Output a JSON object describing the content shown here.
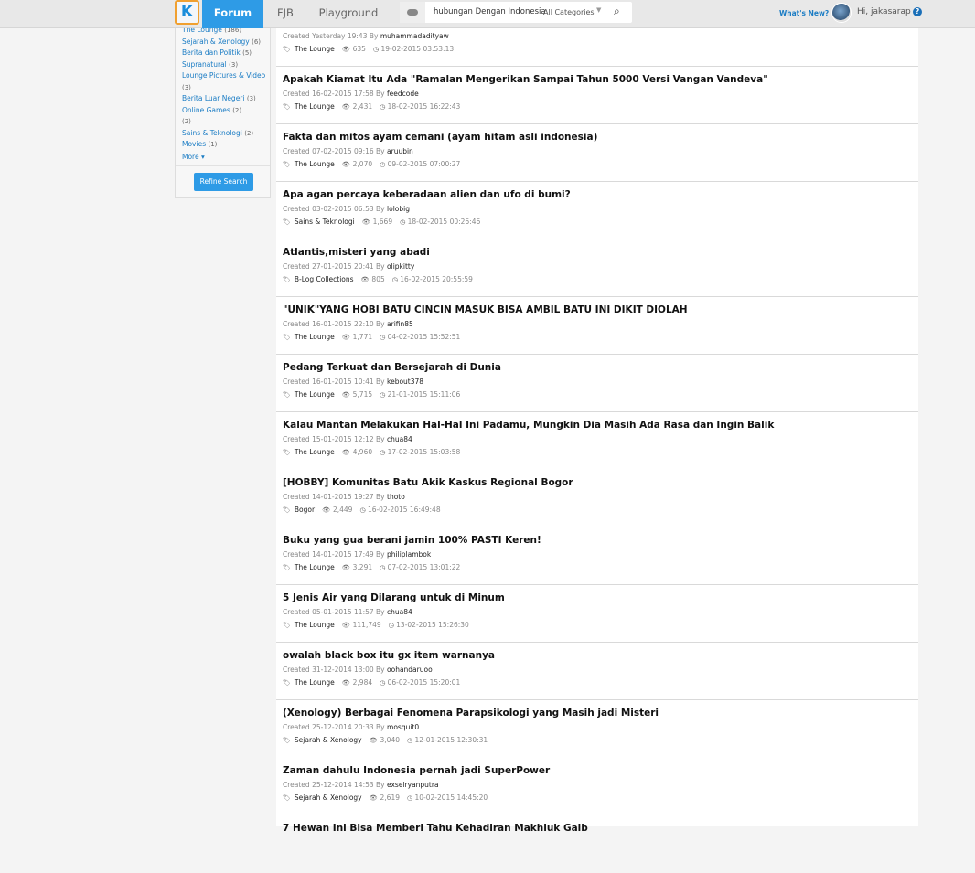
{
  "header": {
    "logo": "K",
    "nav": [
      {
        "label": "Forum",
        "active": true
      },
      {
        "label": "FJB"
      },
      {
        "label": "Playground"
      }
    ],
    "search": {
      "query": "hubungan Dengan Indonesia",
      "category": "All Categories"
    },
    "whats_new": "What's New?",
    "greeting": "Hi, jakasarap",
    "help": "?"
  },
  "sidebar": {
    "categories": [
      {
        "name": "The Lounge",
        "count": "(186)"
      },
      {
        "name": "Sejarah & Xenology",
        "count": "(6)"
      },
      {
        "name": "Berita dan Politik",
        "count": "(5)"
      },
      {
        "name": "Supranatural",
        "count": "(3)"
      },
      {
        "name": "Lounge Pictures & Video",
        "count": "(3)"
      },
      {
        "name": "Berita Luar Negeri",
        "count": "(3)"
      },
      {
        "name": "Online Games",
        "count": "(2)"
      },
      {
        "name": "",
        "count": "(2)"
      },
      {
        "name": "Sains & Teknologi",
        "count": "(2)"
      },
      {
        "name": "Movies",
        "count": "(1)"
      }
    ],
    "more": "More ▾",
    "refine": "Refine Search"
  },
  "threads": [
    {
      "title": "",
      "created": "Created Yesterday 19:43 By",
      "user": "muhammadadityaw",
      "tag": "The Lounge",
      "views": "635",
      "updated": "19-02-2015 03:53:13",
      "separator": true
    },
    {
      "title": "Apakah Kiamat Itu Ada \"Ramalan Mengerikan Sampai Tahun 5000 Versi Vangan Vandeva\"",
      "created": "Created 16-02-2015 17:58 By",
      "user": "feedcode",
      "tag": "The Lounge",
      "views": "2,431",
      "updated": "18-02-2015 16:22:43",
      "separator": true
    },
    {
      "title": "Fakta dan mitos ayam cemani (ayam hitam asli indonesia)",
      "created": "Created 07-02-2015 09:16 By",
      "user": "aruubin",
      "tag": "The Lounge",
      "views": "2,070",
      "updated": "09-02-2015 07:00:27",
      "separator": true
    },
    {
      "title": "Apa agan percaya keberadaan alien dan ufo di bumi?",
      "created": "Created 03-02-2015 06:53 By",
      "user": "lolobig",
      "tag": "Sains & Teknologi",
      "views": "1,669",
      "updated": "18-02-2015 00:26:46",
      "separator": false
    },
    {
      "title": "Atlantis,misteri yang abadi",
      "created": "Created 27-01-2015 20:41 By",
      "user": "olipkitty",
      "tag": "B-Log Collections",
      "views": "805",
      "updated": "16-02-2015 20:55:59",
      "separator": true
    },
    {
      "title": "\"UNIK\"YANG HOBI BATU CINCIN MASUK BISA AMBIL BATU INI DIKIT DIOLAH",
      "created": "Created 16-01-2015 22:10 By",
      "user": "arifin85",
      "tag": "The Lounge",
      "views": "1,771",
      "updated": "04-02-2015 15:52:51",
      "separator": true
    },
    {
      "title": "Pedang Terkuat dan Bersejarah di Dunia",
      "created": "Created 16-01-2015 10:41 By",
      "user": "kebout378",
      "tag": "The Lounge",
      "views": "5,715",
      "updated": "21-01-2015 15:11:06",
      "separator": true
    },
    {
      "title": "Kalau Mantan Melakukan Hal-Hal Ini Padamu, Mungkin Dia Masih Ada Rasa dan Ingin Balik",
      "created": "Created 15-01-2015 12:12 By",
      "user": "chua84",
      "tag": "The Lounge",
      "views": "4,960",
      "updated": "17-02-2015 15:03:58",
      "separator": false
    },
    {
      "title": "[HOBBY] Komunitas Batu Akik Kaskus Regional Bogor",
      "created": "Created 14-01-2015 19:27 By",
      "user": "thoto",
      "tag": "Bogor",
      "views": "2,449",
      "updated": "16-02-2015 16:49:48",
      "separator": false
    },
    {
      "title": "Buku yang gua berani jamin 100% PASTI Keren!",
      "created": "Created 14-01-2015 17:49 By",
      "user": "philiplambok",
      "tag": "The Lounge",
      "views": "3,291",
      "updated": "07-02-2015 13:01:22",
      "separator": true
    },
    {
      "title": "5 Jenis Air yang Dilarang untuk di Minum",
      "created": "Created 05-01-2015 11:57 By",
      "user": "chua84",
      "tag": "The Lounge",
      "views": "111,749",
      "updated": "13-02-2015 15:26:30",
      "separator": true
    },
    {
      "title": "owalah black box itu gx item warnanya",
      "created": "Created 31-12-2014 13:00 By",
      "user": "oohandaruoo",
      "tag": "The Lounge",
      "views": "2,984",
      "updated": "06-02-2015 15:20:01",
      "separator": true
    },
    {
      "title": "(Xenology) Berbagai Fenomena Parapsikologi yang Masih jadi Misteri",
      "created": "Created 25-12-2014 20:33 By",
      "user": "mosquit0",
      "tag": "Sejarah & Xenology",
      "views": "3,040",
      "updated": "12-01-2015 12:30:31",
      "separator": false
    },
    {
      "title": "Zaman dahulu Indonesia pernah jadi SuperPower",
      "created": "Created 25-12-2014 14:53 By",
      "user": "exselryanputra",
      "tag": "Sejarah & Xenology",
      "views": "2,619",
      "updated": "10-02-2015 14:45:20",
      "separator": false
    },
    {
      "title": "7 Hewan Ini Bisa Memberi Tahu Kehadiran Makhluk Gaib",
      "created": "",
      "user": "",
      "tag": "",
      "views": "",
      "updated": "",
      "separator": false
    }
  ]
}
